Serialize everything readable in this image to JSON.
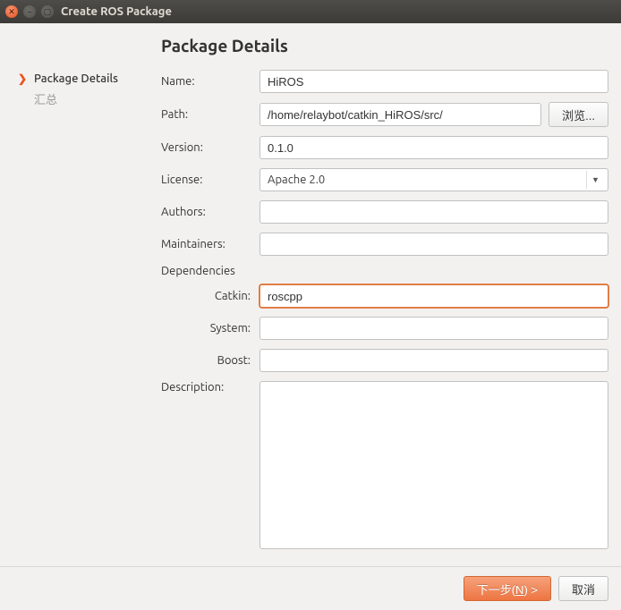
{
  "window": {
    "title": "Create ROS Package"
  },
  "sidebar": {
    "items": [
      {
        "label": "Package Details",
        "active": true
      },
      {
        "label": "汇总",
        "active": false
      }
    ]
  },
  "main": {
    "heading": "Package Details",
    "labels": {
      "name": "Name:",
      "path": "Path:",
      "version": "Version:",
      "license": "License:",
      "authors": "Authors:",
      "maintainers": "Maintainers:",
      "dependencies": "Dependencies",
      "catkin": "Catkin:",
      "system": "System:",
      "boost": "Boost:",
      "description": "Description:"
    },
    "fields": {
      "name": "HiROS",
      "path": "/home/relaybot/catkin_HiROS/src/",
      "version": "0.1.0",
      "license": "Apache 2.0",
      "authors": "",
      "maintainers": "",
      "catkin": "roscpp",
      "system": "",
      "boost": "",
      "description": ""
    },
    "buttons": {
      "browse": "浏览..."
    }
  },
  "footer": {
    "next": "下一步(N) >",
    "cancel": "取消"
  },
  "watermark": ""
}
